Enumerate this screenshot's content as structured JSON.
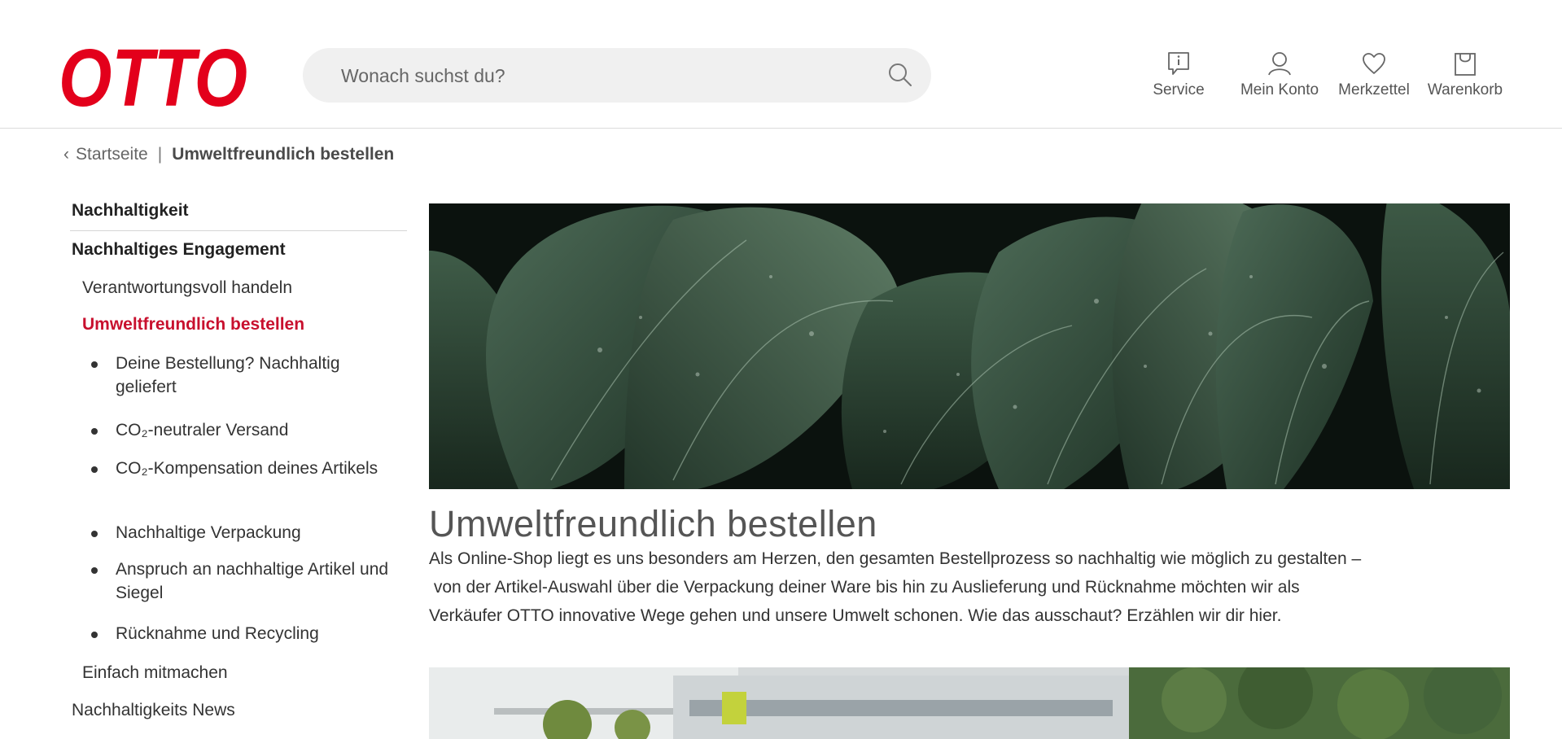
{
  "header": {
    "logo_text": "OTTO",
    "search": {
      "placeholder": "Wonach suchst du?"
    },
    "nav": {
      "service": "Service",
      "account": "Mein Konto",
      "wishlist": "Merkzettel",
      "cart": "Warenkorb"
    }
  },
  "breadcrumb": {
    "back_icon": "chevron-left-icon",
    "home": "Startseite",
    "separator": "|",
    "current": "Umweltfreundlich bestellen"
  },
  "sidebar": {
    "section_title": "Nachhaltigkeit",
    "group_title": "Nachhaltiges Engagement",
    "items": [
      "Verantwortungsvoll handeln",
      "Umweltfreundlich bestellen"
    ],
    "subitems": [
      "Deine Bestellung? Nachhaltig geliefert",
      "CO₂-neutraler Versand",
      "CO₂-Kompensation deines Artikels",
      "Nachhaltige Verpackung",
      "Anspruch an nachhaltige Artikel und Siegel",
      "Rücknahme und Recycling"
    ],
    "more_items": [
      "Einfach mitmachen",
      "Nachhaltigkeits News"
    ]
  },
  "main": {
    "title": "Umweltfreundlich bestellen",
    "text_lines": [
      "Als Online-Shop liegt es uns besonders am Herzen, den gesamten Bestellprozess so nachhaltig wie möglich zu gestalten –",
      " von der Artikel-Auswahl über die Verpackung deiner Ware bis hin zu Auslieferung und Rücknahme möchten wir als",
      "Verkäufer OTTO innovative Wege gehen und unsere Umwelt schonen. Wie das ausschaut? Erzählen wir dir hier."
    ]
  },
  "colors": {
    "brand_red": "#e3001b",
    "active_link": "#c8102e",
    "search_bg": "#f0f0f0"
  }
}
